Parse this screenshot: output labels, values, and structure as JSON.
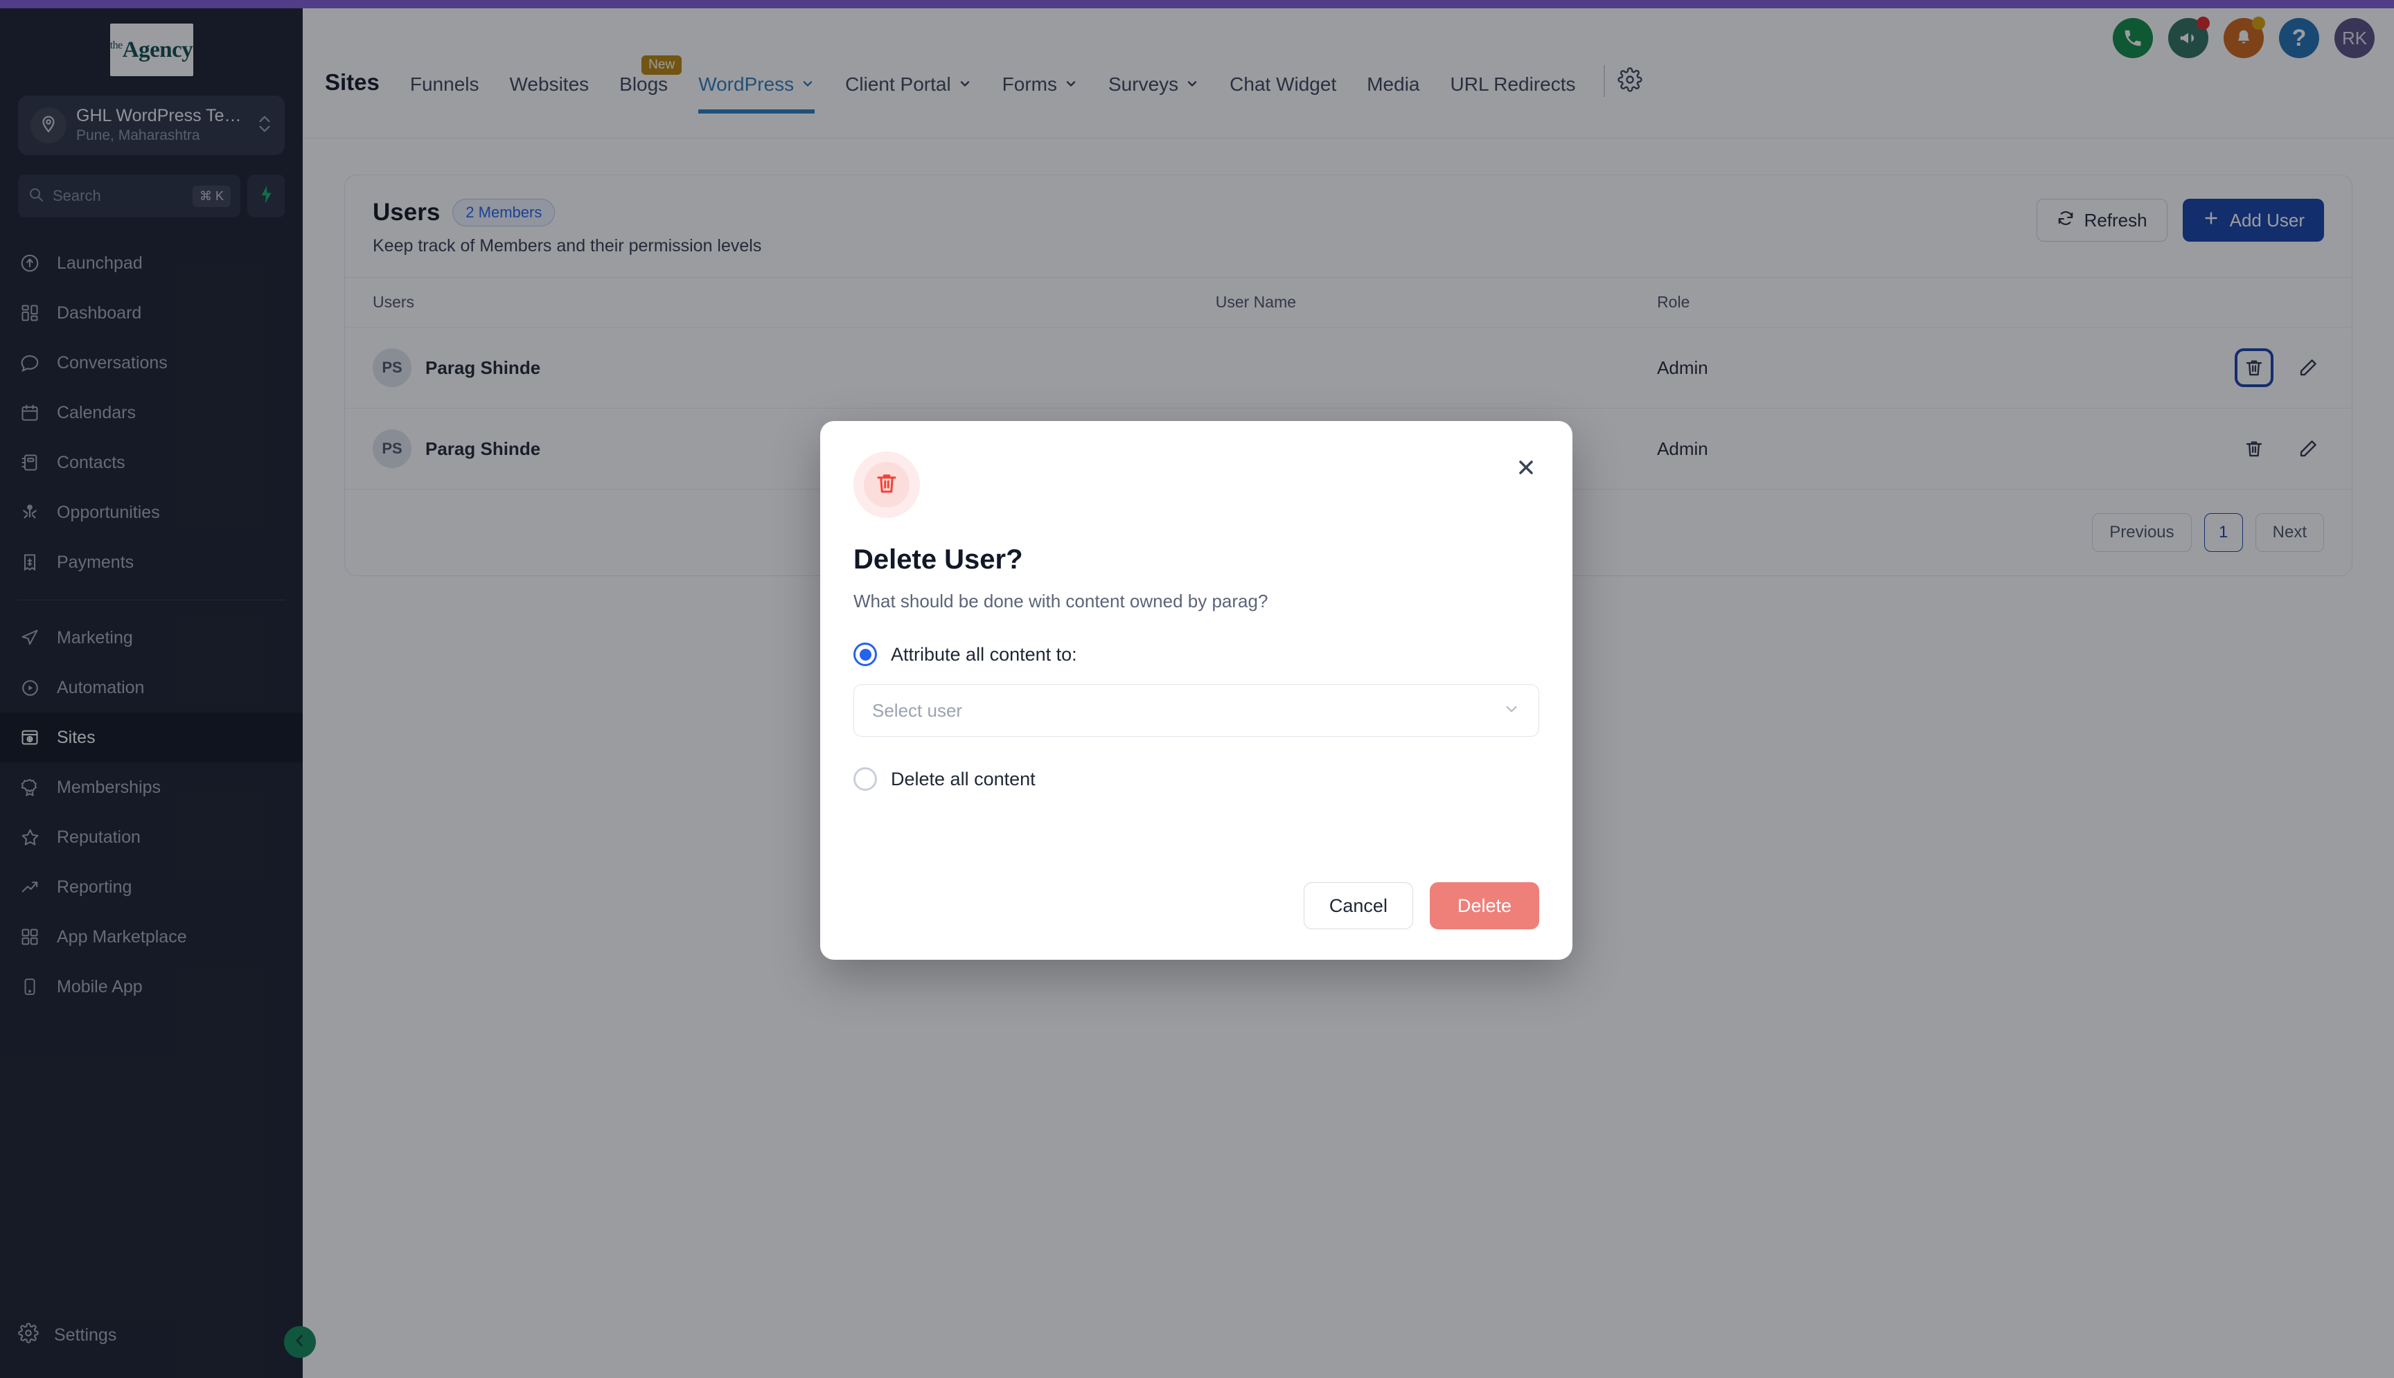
{
  "brand": {
    "logo_prefix": "the",
    "logo_name": "Agency",
    "accent_purple": "#7e5bd4"
  },
  "sidebar": {
    "location": {
      "name": "GHL WordPress Team",
      "sub": "Pune, Maharashtra",
      "icon": "location-pin-icon"
    },
    "search": {
      "placeholder": "Search",
      "shortcut": "⌘ K",
      "bolt_icon": "lightning-bolt-icon"
    },
    "items_primary": [
      {
        "label": "Launchpad",
        "icon": "rocket-launchpad-icon"
      },
      {
        "label": "Dashboard",
        "icon": "dashboard-grid-icon"
      },
      {
        "label": "Conversations",
        "icon": "chat-bubble-icon"
      },
      {
        "label": "Calendars",
        "icon": "calendar-icon"
      },
      {
        "label": "Contacts",
        "icon": "contacts-book-icon"
      },
      {
        "label": "Opportunities",
        "icon": "opportunities-icon"
      },
      {
        "label": "Payments",
        "icon": "payments-receipt-icon"
      }
    ],
    "items_secondary": [
      {
        "label": "Marketing",
        "icon": "paper-plane-icon"
      },
      {
        "label": "Automation",
        "icon": "play-circle-icon"
      },
      {
        "label": "Sites",
        "icon": "browser-window-icon",
        "active": true
      },
      {
        "label": "Memberships",
        "icon": "award-badge-icon"
      },
      {
        "label": "Reputation",
        "icon": "star-icon"
      },
      {
        "label": "Reporting",
        "icon": "trending-up-icon"
      },
      {
        "label": "App Marketplace",
        "icon": "apps-grid-icon"
      },
      {
        "label": "Mobile App",
        "icon": "mobile-phone-icon"
      }
    ],
    "settings": {
      "label": "Settings",
      "icon": "gear-icon"
    },
    "collapse": {
      "icon": "chevron-left-icon"
    }
  },
  "header": {
    "icons": [
      {
        "name": "phone-icon",
        "color": "#0f8a46",
        "dot": null
      },
      {
        "name": "megaphone-icon",
        "color": "#2f6f5e",
        "dot": "#dc2626"
      },
      {
        "name": "bell-icon",
        "color": "#cc6515",
        "dot": "#d8a20a"
      },
      {
        "name": "help-question-icon",
        "color": "#1f6fb2",
        "dot": null
      }
    ],
    "avatar": {
      "initials": "RK",
      "color": "#554f80"
    }
  },
  "nav": {
    "page_title": "Sites",
    "tabs": [
      {
        "label": "Funnels",
        "caret": false,
        "badge": null,
        "active": false
      },
      {
        "label": "Websites",
        "caret": false,
        "badge": null,
        "active": false
      },
      {
        "label": "Blogs",
        "caret": false,
        "badge": "New",
        "active": false
      },
      {
        "label": "WordPress",
        "caret": true,
        "badge": null,
        "active": true
      },
      {
        "label": "Client Portal",
        "caret": true,
        "badge": null,
        "active": false
      },
      {
        "label": "Forms",
        "caret": true,
        "badge": null,
        "active": false
      },
      {
        "label": "Surveys",
        "caret": true,
        "badge": null,
        "active": false
      },
      {
        "label": "Chat Widget",
        "caret": false,
        "badge": null,
        "active": false
      },
      {
        "label": "Media",
        "caret": false,
        "badge": null,
        "active": false
      },
      {
        "label": "URL Redirects",
        "caret": false,
        "badge": null,
        "active": false
      }
    ],
    "settings_gear": "gear-icon"
  },
  "users_card": {
    "title": "Users",
    "member_pill": "2 Members",
    "subtitle": "Keep track of Members and their permission levels",
    "refresh_label": "Refresh",
    "refresh_icon": "refresh-icon",
    "add_user_label": "Add User",
    "add_user_icon": "plus-icon",
    "columns": [
      "Users",
      "User Name",
      "Role"
    ],
    "rows": [
      {
        "initials": "PS",
        "name": "Parag Shinde",
        "user_name": "",
        "role": "Admin",
        "delete_icon": "trash-icon",
        "edit_icon": "pencil-icon",
        "delete_focused": true
      },
      {
        "initials": "PS",
        "name": "Parag Shinde",
        "user_name": "",
        "role": "Admin",
        "delete_icon": "trash-icon",
        "edit_icon": "pencil-icon",
        "delete_focused": false
      }
    ],
    "pagination": {
      "previous": "Previous",
      "current_page": "1",
      "next": "Next"
    }
  },
  "modal": {
    "icon": "trash-icon",
    "title": "Delete User?",
    "subtitle": "What should be done with content owned by parag?",
    "close_icon": "close-icon",
    "option_attribute": {
      "label": "Attribute all content to:",
      "selected": true
    },
    "select_user": {
      "placeholder": "Select user",
      "caret_icon": "chevron-down-icon"
    },
    "option_delete_all": {
      "label": "Delete all content",
      "selected": false
    },
    "cancel_label": "Cancel",
    "delete_label": "Delete",
    "delete_color": "#ef8079"
  }
}
